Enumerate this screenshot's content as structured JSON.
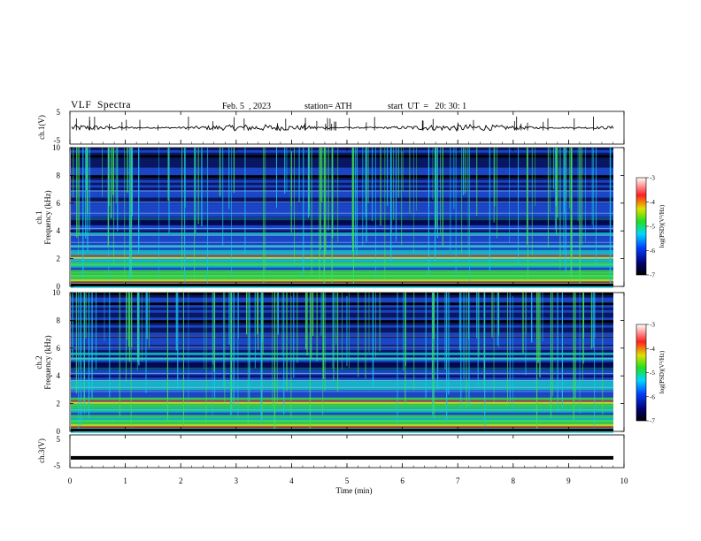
{
  "header": {
    "title": "VLF  Spectra",
    "date": "Feb. 5  , 2023",
    "station": "station= ATH",
    "start": "start  UT  =   20: 30: 1"
  },
  "chart_data": [
    {
      "type": "line",
      "panel": "ch1-waveform",
      "ylabel": "ch.1(V)",
      "ylim": [
        -5,
        5
      ],
      "yticks": [
        "5",
        "-5"
      ],
      "xlim": [
        0,
        10
      ],
      "series_mean": 0,
      "series_amplitude": 1
    },
    {
      "type": "heatmap",
      "panel": "ch1-spectrogram",
      "ylabel": "ch.1\nFrequency (kHz)",
      "ylim": [
        0,
        10
      ],
      "yticks": [
        "10",
        "8",
        "6",
        "4",
        "2",
        "0"
      ],
      "xlim": [
        0,
        10
      ],
      "colorbar": {
        "label": "log(PSD)(V²/Hz)",
        "range": [
          -7,
          -3
        ],
        "ticks": [
          "-3",
          "-4",
          "-5",
          "-6",
          "-7"
        ]
      }
    },
    {
      "type": "heatmap",
      "panel": "ch2-spectrogram",
      "ylabel": "ch.2\nFrequency (kHz)",
      "ylim": [
        0,
        10
      ],
      "yticks": [
        "10",
        "8",
        "6",
        "4",
        "2",
        "0"
      ],
      "xlim": [
        0,
        10
      ],
      "colorbar": {
        "label": "log(PSD)(V²/Hz)",
        "range": [
          -7,
          -3
        ],
        "ticks": [
          "-3",
          "-4",
          "-5",
          "-6",
          "-7"
        ]
      }
    },
    {
      "type": "line",
      "panel": "ch3-waveform",
      "ylabel": "ch.3(V)",
      "ylim": [
        -5,
        5
      ],
      "yticks": [
        "5",
        "-5"
      ],
      "xlim": [
        0,
        10
      ],
      "series_mean": -2,
      "series_amplitude": 0.1
    }
  ],
  "xaxis": {
    "label": "Time  (min)",
    "ticks": [
      "0",
      "1",
      "2",
      "3",
      "4",
      "5",
      "6",
      "7",
      "8",
      "9",
      "10"
    ],
    "range": [
      0,
      10
    ]
  },
  "colors": {
    "background": "#000000",
    "deep": "#0a1a6e",
    "blue": "#1f4fe0",
    "cyan": "#19c9e0",
    "green": "#3ee05a",
    "yellow": "#e8e020",
    "red": "#e01818"
  }
}
